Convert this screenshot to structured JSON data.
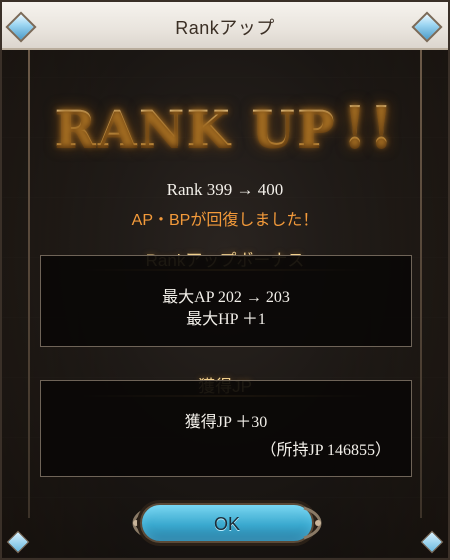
{
  "dialog": {
    "title": "Rankアップ",
    "headline": "RANK UP",
    "headline_mark": "!!",
    "rank_change": "Rank 399 → 400",
    "recover_message": "AP・BPが回復しました！"
  },
  "bonus": {
    "title": "Rankアップボーナス",
    "lines": [
      "最大AP 202 → 203",
      "最大HP ＋1"
    ]
  },
  "jp": {
    "title": "獲得JP",
    "gained": "獲得JP ＋30",
    "owned": "（所持JP 146855）"
  },
  "actions": {
    "ok_label": "OK"
  },
  "colors": {
    "title_bar": "#eee9e2",
    "accent_gold": "#f1d08d",
    "recover_orange": "#f39a3a",
    "button_blue": "#3aa9cf"
  }
}
